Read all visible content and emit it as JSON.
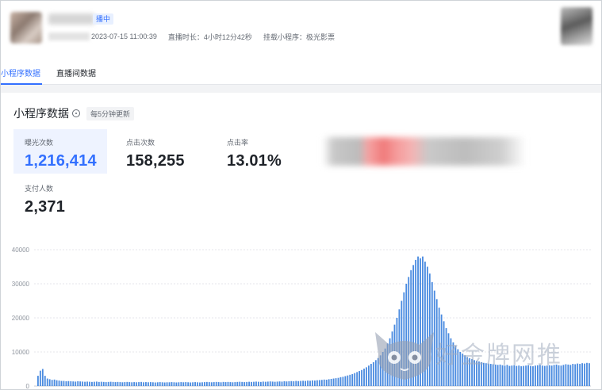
{
  "header": {
    "live_badge": "播中",
    "start_time": "2023-07-15 11:00:39",
    "duration_label": "直播时长：4小时12分42秒",
    "mini_program_label": "挂载小程序：极光影票"
  },
  "tabs": [
    {
      "label": "小程序数据",
      "active": true
    },
    {
      "label": "直播间数据",
      "active": false
    }
  ],
  "section": {
    "title": "小程序数据",
    "update_note": "每5分钟更新"
  },
  "metrics": [
    {
      "label": "曝光次数",
      "value": "1,216,414",
      "active": true
    },
    {
      "label": "点击次数",
      "value": "158,255",
      "active": false
    },
    {
      "label": "点击率",
      "value": "13.01%",
      "active": false
    },
    {
      "label": "支付人数",
      "value": "2,371",
      "active": false
    }
  ],
  "colors": {
    "accent": "#3370ff",
    "bar": "#4a8be0"
  },
  "watermark": {
    "text": "好金牌网推"
  },
  "chart_data": {
    "type": "bar",
    "ylim": [
      0,
      40000
    ],
    "yticks": [
      "40000",
      "30000",
      "20000",
      "10000",
      "0"
    ],
    "yvalues": [
      40000,
      30000,
      20000,
      10000,
      0
    ],
    "grid": true,
    "values": [
      3000,
      4500,
      5000,
      3000,
      2200,
      2000,
      1800,
      1900,
      1700,
      1600,
      1500,
      1500,
      1400,
      1450,
      1400,
      1350,
      1300,
      1400,
      1350,
      1300,
      1250,
      1300,
      1250,
      1200,
      1250,
      1300,
      1200,
      1250,
      1200,
      1150,
      1200,
      1250,
      1200,
      1150,
      1200,
      1150,
      1100,
      1150,
      1200,
      1150,
      1100,
      1150,
      1100,
      1150,
      1200,
      1100,
      1150,
      1100,
      1150,
      1100,
      1050,
      1100,
      1150,
      1100,
      1050,
      1100,
      1100,
      1150,
      1100,
      1050,
      1100,
      1150,
      1100,
      1150,
      1100,
      1050,
      1100,
      1150,
      1100,
      1050,
      1100,
      1150,
      1200,
      1150,
      1100,
      1150,
      1200,
      1150,
      1100,
      1200,
      1150,
      1200,
      1150,
      1100,
      1150,
      1200,
      1250,
      1200,
      1150,
      1200,
      1250,
      1200,
      1250,
      1300,
      1250,
      1200,
      1300,
      1250,
      1300,
      1350,
      1300,
      1250,
      1300,
      1350,
      1300,
      1400,
      1350,
      1400,
      1450,
      1400,
      1500,
      1450,
      1500,
      1550,
      1500,
      1600,
      1550,
      1650,
      1600,
      1700,
      1750,
      1800,
      1900,
      1850,
      2000,
      2100,
      2200,
      2300,
      2400,
      2600,
      2700,
      2900,
      3100,
      3300,
      3500,
      3800,
      4100,
      4400,
      4700,
      5100,
      5500,
      6000,
      6500,
      7000,
      7600,
      8200,
      9000,
      10000,
      11000,
      12500,
      14000,
      16000,
      18000,
      20000,
      22500,
      25000,
      27500,
      30000,
      32000,
      34000,
      35500,
      37000,
      38000,
      37500,
      38000,
      36500,
      35000,
      33000,
      30500,
      28000,
      25500,
      23000,
      21000,
      19000,
      17000,
      15500,
      14000,
      12800,
      11800,
      10800,
      10000,
      9500,
      9000,
      8500,
      8200,
      7900,
      7600,
      7400,
      7200,
      7000,
      6800,
      6700,
      6600,
      6500,
      6400,
      6300,
      6200,
      6300,
      6100,
      6000,
      6200,
      5900,
      6000,
      6100,
      5900,
      6000,
      5800,
      5900,
      6000,
      6100,
      5900,
      5800,
      6000,
      6100,
      6200,
      6000,
      5900,
      6000,
      6100,
      6000,
      6200,
      6300,
      6100,
      6000,
      6200,
      6400,
      6300,
      6200,
      6500,
      6400,
      6600,
      6500,
      6700,
      6600,
      6800,
      6700
    ]
  }
}
